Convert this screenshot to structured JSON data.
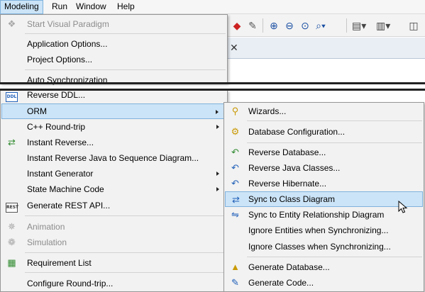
{
  "menubar": {
    "items": [
      {
        "label": "Modeling",
        "active": true
      },
      {
        "label": "Run",
        "active": false
      },
      {
        "label": "Window",
        "active": false
      },
      {
        "label": "Help",
        "active": false
      }
    ]
  },
  "toolbar": {
    "icons": [
      "model-icon",
      "brush-icon",
      "zoom-in-icon",
      "zoom-out-icon",
      "zoom-fit-icon",
      "zoom-dropdown-icon",
      "align-icon",
      "distribute-icon"
    ]
  },
  "modeling_menu": {
    "top_items": [
      {
        "label": "Start Visual Paradigm",
        "icon": "visual-paradigm-icon",
        "disabled": true
      },
      {
        "label": "Application Options...",
        "icon": "",
        "disabled": false
      },
      {
        "label": "Project Options...",
        "icon": "",
        "disabled": false
      },
      {
        "label": "Auto Synchronization",
        "icon": "",
        "disabled": false
      }
    ],
    "items": [
      {
        "label": "Reverse DDL...",
        "icon": "ddl-icon",
        "submenu": false,
        "disabled": false
      },
      {
        "label": "ORM",
        "icon": "",
        "submenu": true,
        "disabled": false,
        "highlighted": true
      },
      {
        "label": "C++ Round-trip",
        "icon": "",
        "submenu": true,
        "disabled": false
      },
      {
        "label": "Instant Reverse...",
        "icon": "instant-reverse-icon",
        "submenu": false,
        "disabled": false
      },
      {
        "label": "Instant Reverse Java to Sequence Diagram...",
        "icon": "",
        "submenu": false,
        "disabled": false
      },
      {
        "label": "Instant Generator",
        "icon": "",
        "submenu": true,
        "disabled": false
      },
      {
        "label": "State Machine Code",
        "icon": "",
        "submenu": true,
        "disabled": false
      },
      {
        "label": "Generate REST API...",
        "icon": "rest-icon",
        "submenu": false,
        "disabled": false
      },
      {
        "label": "Animation",
        "icon": "animation-icon",
        "submenu": false,
        "disabled": true
      },
      {
        "label": "Simulation",
        "icon": "simulation-icon",
        "submenu": false,
        "disabled": true
      },
      {
        "label": "Requirement List",
        "icon": "requirement-list-icon",
        "submenu": false,
        "disabled": false
      },
      {
        "label": "Configure Round-trip...",
        "icon": "",
        "submenu": false,
        "disabled": false
      }
    ]
  },
  "orm_submenu": {
    "items": [
      {
        "label": "Wizards...",
        "icon": "wizard-icon"
      },
      {
        "label": "Database Configuration...",
        "icon": "database-config-icon"
      },
      {
        "label": "Reverse Database...",
        "icon": "reverse-database-icon"
      },
      {
        "label": "Reverse Java Classes...",
        "icon": "reverse-java-icon"
      },
      {
        "label": "Reverse Hibernate...",
        "icon": "reverse-hibernate-icon"
      },
      {
        "label": "Sync to Class Diagram",
        "icon": "sync-class-diagram-icon",
        "highlighted": true
      },
      {
        "label": "Sync to Entity Relationship Diagram",
        "icon": "sync-erd-icon"
      },
      {
        "label": "Ignore Entities when Synchronizing...",
        "icon": ""
      },
      {
        "label": "Ignore Classes when Synchronizing...",
        "icon": ""
      },
      {
        "label": "Generate Database...",
        "icon": "generate-database-icon"
      },
      {
        "label": "Generate Code...",
        "icon": "generate-code-icon"
      }
    ]
  },
  "colors": {
    "highlight": "#cce4f7",
    "highlight_border": "#7fb2dd",
    "menu_bg": "#f2f2f2",
    "disabled_text": "#8c8c8c"
  }
}
